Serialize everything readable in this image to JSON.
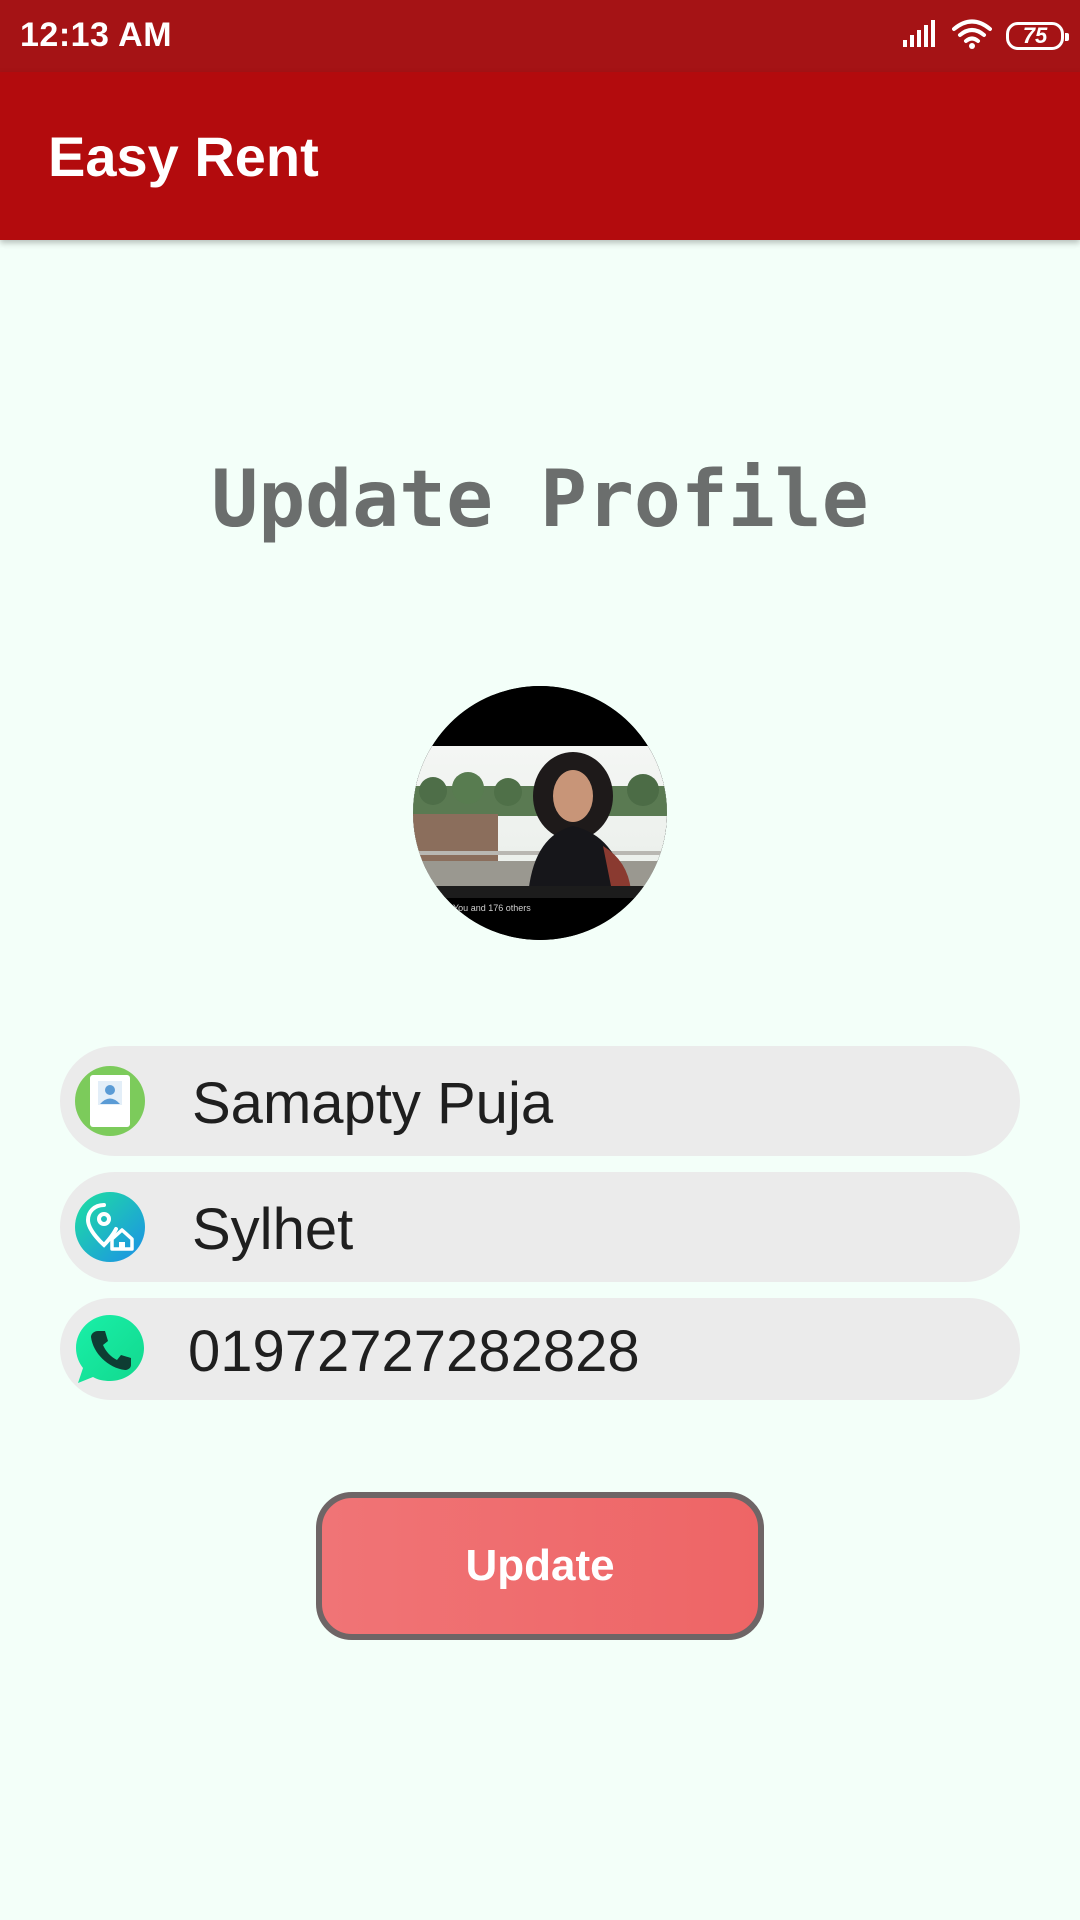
{
  "status_bar": {
    "time": "12:13 AM",
    "battery": "75",
    "signal_icon": "signal-icon",
    "wifi_icon": "wifi-icon",
    "battery_icon": "battery-icon"
  },
  "app_bar": {
    "title": "Easy Rent"
  },
  "page": {
    "heading": "Update Profile"
  },
  "profile": {
    "avatar_icon": "profile-photo"
  },
  "form": {
    "name": {
      "value": "Samapty Puja",
      "icon": "contact-card-icon"
    },
    "location": {
      "value": "Sylhet",
      "icon": "location-home-icon"
    },
    "phone": {
      "value": "01972727282828",
      "icon": "phone-icon"
    }
  },
  "actions": {
    "update_label": "Update"
  },
  "colors": {
    "status_bar": "#A51315",
    "app_bar": "#B30B0D",
    "background": "#F3FFF9",
    "field_bg": "#EBEBEB",
    "button": "#F07476",
    "button_border": "#6E6566",
    "heading": "#6B6E6D"
  }
}
